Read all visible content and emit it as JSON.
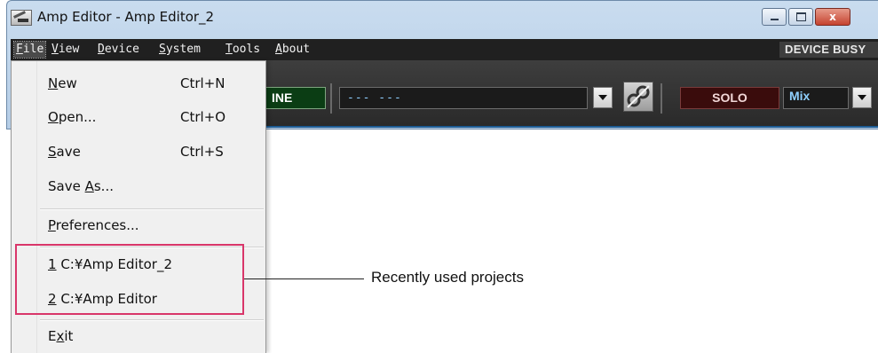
{
  "window": {
    "title": "Amp Editor - Amp Editor_2",
    "close_glyph": "x"
  },
  "menubar": {
    "items": [
      {
        "label": "File",
        "mnemonic": "F",
        "rest": "ile"
      },
      {
        "label": "View",
        "mnemonic": "V",
        "rest": "iew"
      },
      {
        "label": "Device",
        "mnemonic": "D",
        "rest": "evice"
      },
      {
        "label": "System",
        "mnemonic": "S",
        "rest": "ystem"
      },
      {
        "label": "Tools",
        "mnemonic": "T",
        "rest": "ools"
      },
      {
        "label": "About",
        "mnemonic": "A",
        "rest": "bout"
      }
    ],
    "status": "DEVICE BUSY"
  },
  "toolbar": {
    "online_label": "INE",
    "scene_text": "---  ---",
    "solo_label": "SOLO",
    "mix_label": "Mix"
  },
  "file_menu": {
    "new": {
      "pre": "",
      "key": "N",
      "post": "ew",
      "shortcut": "Ctrl+N"
    },
    "open": {
      "pre": "",
      "key": "O",
      "post": "pen...",
      "shortcut": "Ctrl+O"
    },
    "save": {
      "pre": "",
      "key": "S",
      "post": "ave",
      "shortcut": "Ctrl+S"
    },
    "save_as": {
      "pre": "Save ",
      "key": "A",
      "post": "s..."
    },
    "preferences": {
      "pre": "",
      "key": "P",
      "post": "references..."
    },
    "recent": [
      {
        "key": "1",
        "post": " C:¥Amp Editor_2"
      },
      {
        "key": "2",
        "post": " C:¥Amp Editor"
      }
    ],
    "exit": {
      "pre": "E",
      "key": "x",
      "post": "it"
    }
  },
  "annotation": {
    "recent_label": "Recently used projects",
    "highlight_color": "#d9366a"
  },
  "colors": {
    "menubar_bg": "#202020",
    "online_bg": "#0b3d14",
    "solo_bg": "#3a0c0c",
    "accent_text": "#8fd0ff"
  },
  "icons": [
    "app-icon",
    "minimize-icon",
    "maximize-icon",
    "close-icon",
    "dropdown-arrow-icon",
    "link-icon"
  ]
}
